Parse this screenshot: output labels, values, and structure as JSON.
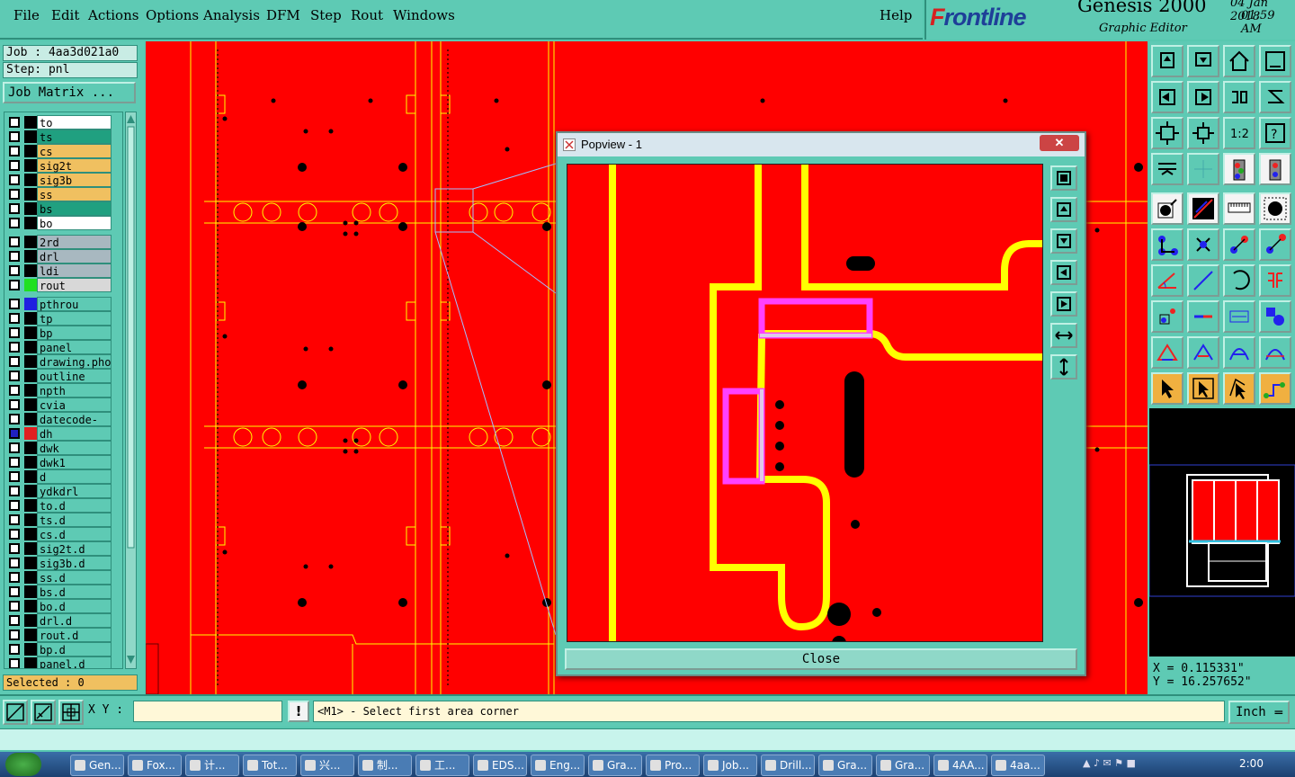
{
  "menu": {
    "items": [
      "File",
      "Edit",
      "Actions",
      "Options",
      "Analysis",
      "DFM",
      "Step",
      "Rout",
      "Windows"
    ],
    "help": "Help"
  },
  "brand": {
    "logo_prefix": "F",
    "logo_rest": "rontline",
    "product": "Genesis 2000",
    "date": "04 Jan 2018",
    "time": "01:59 AM",
    "subtitle": "Graphic Editor"
  },
  "job": {
    "job_label": "Job : 4aa3d021a0",
    "step_label": "Step: pnl",
    "matrix_button": "Job Matrix ..."
  },
  "layers": [
    {
      "name": "to",
      "fill": "#ffffff"
    },
    {
      "name": "ts",
      "fill": "#20a080"
    },
    {
      "name": "cs",
      "fill": "#f0c060"
    },
    {
      "name": "sig2t",
      "fill": "#f0c060"
    },
    {
      "name": "sig3b",
      "fill": "#f0c060"
    },
    {
      "name": "ss",
      "fill": "#f0c060"
    },
    {
      "name": "bs",
      "fill": "#20a080"
    },
    {
      "name": "bo",
      "fill": "#ffffff"
    },
    {
      "name": "2rd",
      "fill": "#a8b8c0"
    },
    {
      "name": "drl",
      "fill": "#a8b8c0"
    },
    {
      "name": "ldi",
      "fill": "#a8b8c0"
    },
    {
      "name": "rout",
      "fill": "#d8d8d8",
      "swatch": "#20e020"
    },
    {
      "name": "pthrou",
      "fill": "#5ecab4",
      "swatch": "#2020e0"
    },
    {
      "name": "tp",
      "fill": "#5ecab4"
    },
    {
      "name": "bp",
      "fill": "#5ecab4"
    },
    {
      "name": "panel",
      "fill": "#5ecab4"
    },
    {
      "name": "drawing.pho",
      "fill": "#5ecab4"
    },
    {
      "name": "outline",
      "fill": "#5ecab4"
    },
    {
      "name": "npth",
      "fill": "#5ecab4"
    },
    {
      "name": "cvia",
      "fill": "#5ecab4"
    },
    {
      "name": "datecode-to",
      "fill": "#5ecab4"
    },
    {
      "name": "dh",
      "fill": "#5ecab4",
      "swatch": "#e02020",
      "active": true
    },
    {
      "name": "dwk",
      "fill": "#5ecab4"
    },
    {
      "name": "dwk1",
      "fill": "#5ecab4"
    },
    {
      "name": "d",
      "fill": "#5ecab4"
    },
    {
      "name": "ydkdrl",
      "fill": "#5ecab4"
    },
    {
      "name": "to.d",
      "fill": "#5ecab4"
    },
    {
      "name": "ts.d",
      "fill": "#5ecab4"
    },
    {
      "name": "cs.d",
      "fill": "#5ecab4"
    },
    {
      "name": "sig2t.d",
      "fill": "#5ecab4"
    },
    {
      "name": "sig3b.d",
      "fill": "#5ecab4"
    },
    {
      "name": "ss.d",
      "fill": "#5ecab4"
    },
    {
      "name": "bs.d",
      "fill": "#5ecab4"
    },
    {
      "name": "bo.d",
      "fill": "#5ecab4"
    },
    {
      "name": "drl.d",
      "fill": "#5ecab4"
    },
    {
      "name": "rout.d",
      "fill": "#5ecab4"
    },
    {
      "name": "bp.d",
      "fill": "#5ecab4"
    },
    {
      "name": "panel.d",
      "fill": "#5ecab4"
    }
  ],
  "selected": "Selected : 0",
  "popview": {
    "title": "Popview - 1",
    "close_label": "Close",
    "close_x": "✕"
  },
  "coords": {
    "x": "X = 0.115331\"",
    "y": "Y = 16.257652\""
  },
  "bottom": {
    "xy_label": "X Y :",
    "xy_value": "",
    "alert": "!",
    "message": "<M1> - Select first area corner",
    "units": "Inch"
  },
  "taskbar": {
    "tasks": [
      "Gen...",
      "Fox...",
      "计...",
      "Tot...",
      "兴...",
      "制...",
      "工...",
      "EDS...",
      "Eng...",
      "Gra...",
      "Pro...",
      "Job...",
      "Drill...",
      "Gra...",
      "Gra...",
      "4AA...",
      "4aa..."
    ],
    "clock": "2:00"
  },
  "colors": {
    "canvas": "#ff0000",
    "trace": "#ffff00",
    "outline": "#ffff00",
    "highlight": "#ff40ff",
    "panel": "#5ecab4"
  }
}
